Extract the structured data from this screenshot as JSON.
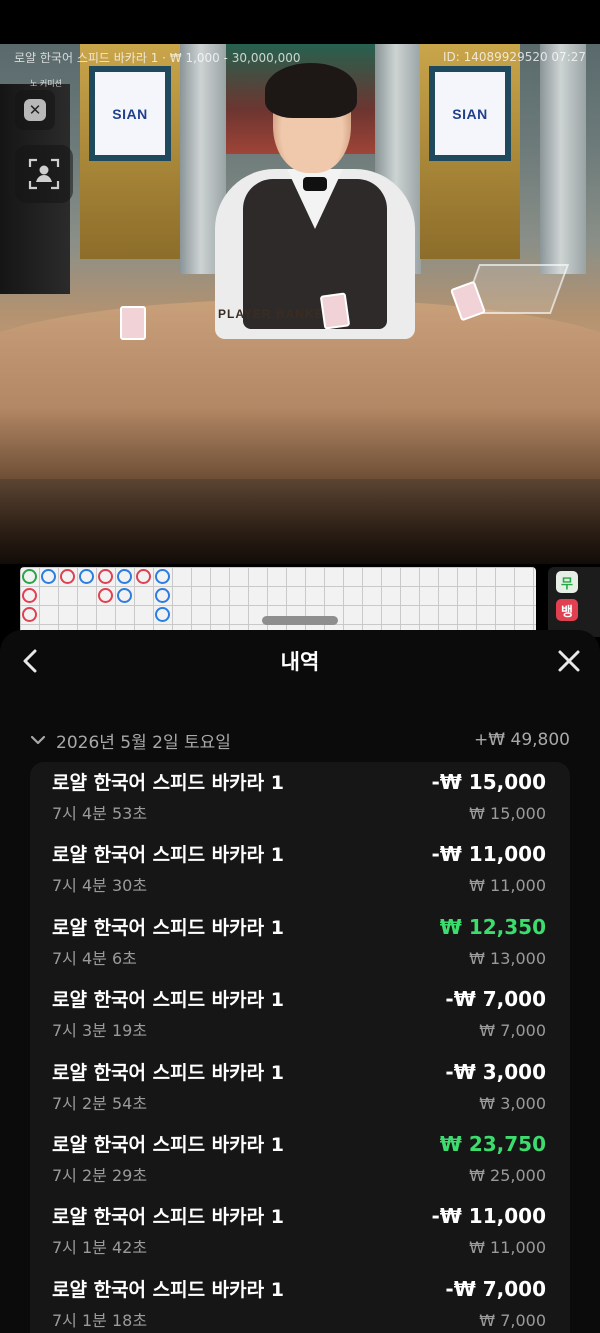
{
  "video": {
    "table_title": "로얄 한국어 스피드 바카라 1 · ₩ 1,000 - 30,000,000",
    "game_id": "ID: 14089929520 07:27",
    "commission_tag": "노 커미션",
    "banner_brand": "SIAN",
    "table_print": "PLAYER    BANKER"
  },
  "side_stats": {
    "tie_label": "무",
    "banker_label": "뱅"
  },
  "scoreboard": {
    "beads": [
      {
        "col": 0,
        "row": 0,
        "color": "g"
      },
      {
        "col": 1,
        "row": 0,
        "color": "b"
      },
      {
        "col": 2,
        "row": 0,
        "color": "r"
      },
      {
        "col": 3,
        "row": 0,
        "color": "b"
      },
      {
        "col": 4,
        "row": 0,
        "color": "r"
      },
      {
        "col": 5,
        "row": 0,
        "color": "b"
      },
      {
        "col": 6,
        "row": 0,
        "color": "r"
      },
      {
        "col": 7,
        "row": 0,
        "color": "b"
      },
      {
        "col": 0,
        "row": 1,
        "color": "r"
      },
      {
        "col": 4,
        "row": 1,
        "color": "r"
      },
      {
        "col": 5,
        "row": 1,
        "color": "b"
      },
      {
        "col": 7,
        "row": 1,
        "color": "b"
      },
      {
        "col": 0,
        "row": 2,
        "color": "r"
      },
      {
        "col": 7,
        "row": 2,
        "color": "b"
      }
    ]
  },
  "history": {
    "title": "내역",
    "day": {
      "date": "2026년 5월 2일 토요일",
      "total": "+₩ 49,800"
    },
    "transactions": [
      {
        "name": "로얄 한국어 스피드 바카라 1",
        "time": "7시 4분 53초",
        "amount": "-₩ 15,000",
        "bet": "₩ 15,000",
        "win": false
      },
      {
        "name": "로얄 한국어 스피드 바카라 1",
        "time": "7시 4분 30초",
        "amount": "-₩ 11,000",
        "bet": "₩ 11,000",
        "win": false
      },
      {
        "name": "로얄 한국어 스피드 바카라 1",
        "time": "7시 4분 6초",
        "amount": "₩ 12,350",
        "bet": "₩ 13,000",
        "win": true
      },
      {
        "name": "로얄 한국어 스피드 바카라 1",
        "time": "7시 3분 19초",
        "amount": "-₩ 7,000",
        "bet": "₩ 7,000",
        "win": false
      },
      {
        "name": "로얄 한국어 스피드 바카라 1",
        "time": "7시 2분 54초",
        "amount": "-₩ 3,000",
        "bet": "₩ 3,000",
        "win": false
      },
      {
        "name": "로얄 한국어 스피드 바카라 1",
        "time": "7시 2분 29초",
        "amount": "₩ 23,750",
        "bet": "₩ 25,000",
        "win": true
      },
      {
        "name": "로얄 한국어 스피드 바카라 1",
        "time": "7시 1분 42초",
        "amount": "-₩ 11,000",
        "bet": "₩ 11,000",
        "win": false
      },
      {
        "name": "로얄 한국어 스피드 바카라 1",
        "time": "7시 1분 18초",
        "amount": "-₩ 7,000",
        "bet": "₩ 7,000",
        "win": false
      }
    ]
  },
  "colors": {
    "win": "#3ddc6e",
    "banker": "#e0404f",
    "player": "#2c7de0",
    "tie": "#28a745"
  }
}
